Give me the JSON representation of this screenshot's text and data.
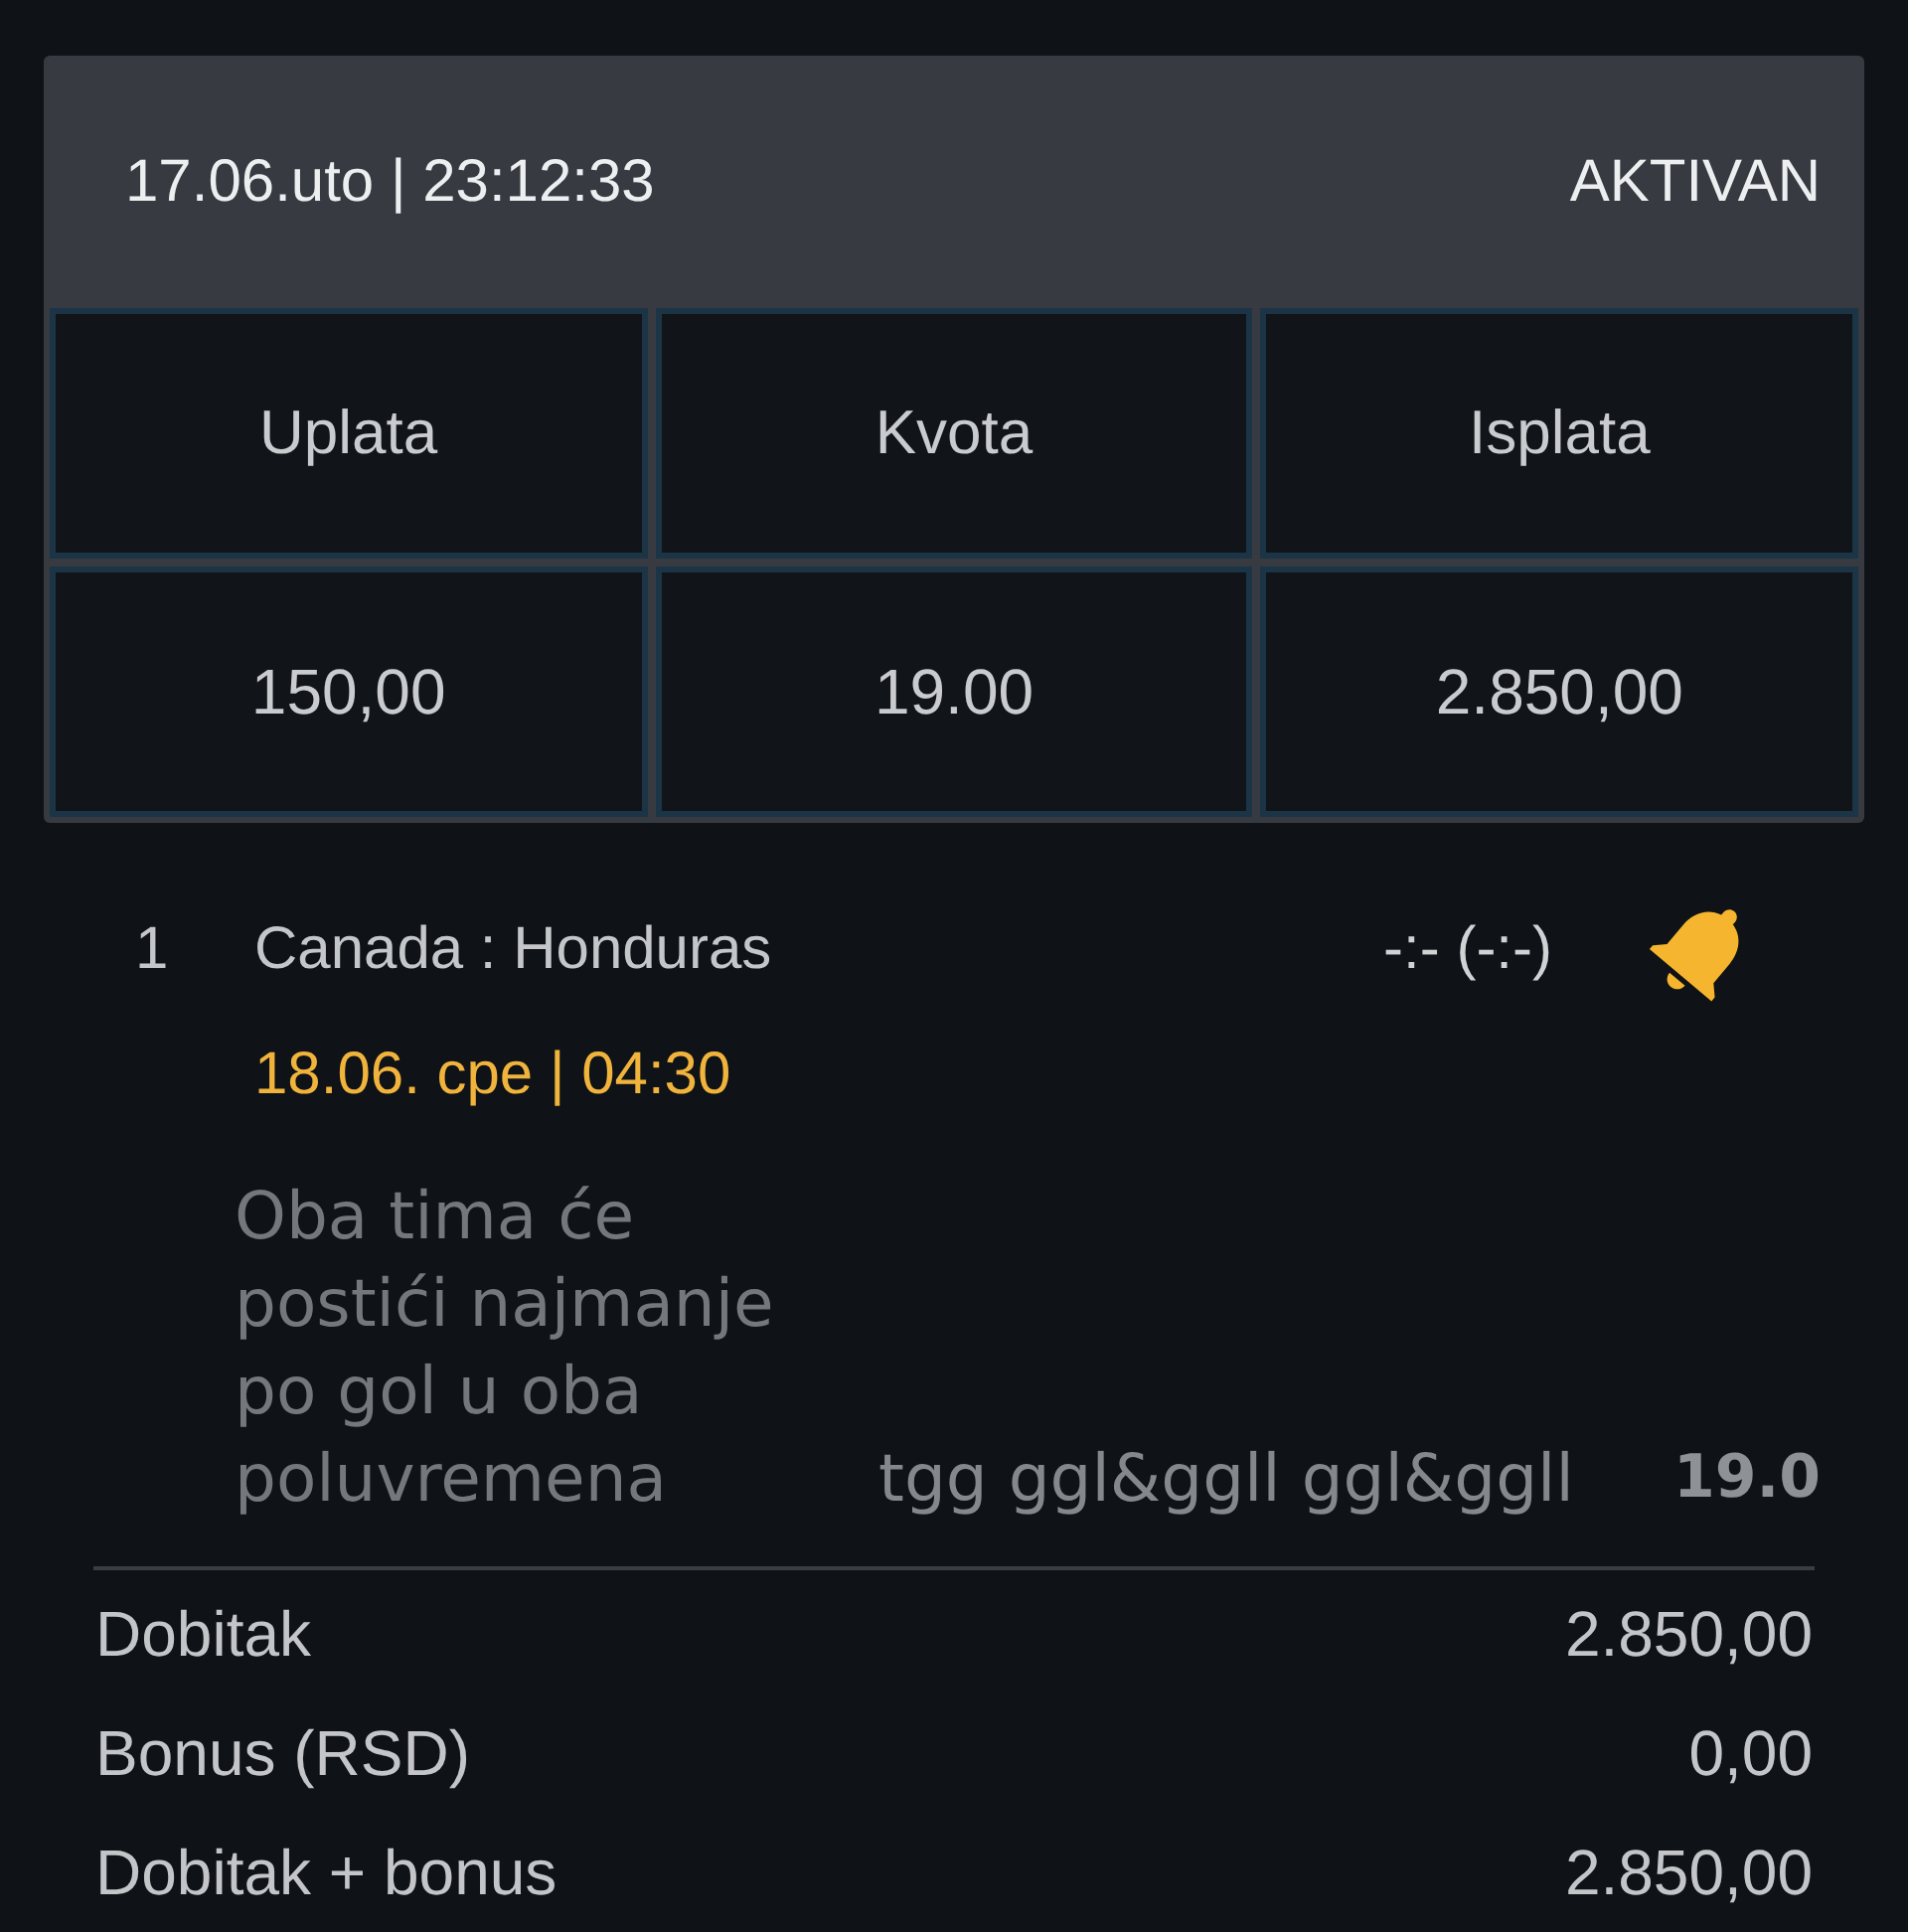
{
  "ticket": {
    "datetime": "17.06.uto | 23:12:33",
    "status": "AKTIVAN"
  },
  "summary_table": {
    "columns": [
      "Uplata",
      "Kvota",
      "Isplata"
    ],
    "values": [
      "150,00",
      "19.00",
      "2.850,00"
    ]
  },
  "matches": [
    {
      "number": "1",
      "teams": "Canada : Honduras",
      "score": "-:- (-:-)",
      "alert_on": true,
      "kickoff": "18.06. cpe | 04:30",
      "market": "Oba tima će postići najmanje po gol u oba poluvremena",
      "pick": "tgg ggl&ggll ggl&ggll",
      "odds": "19.0"
    }
  ],
  "totals": [
    {
      "label": "Dobitak",
      "value": "2.850,00"
    },
    {
      "label": "Bonus (RSD)",
      "value": "0,00"
    },
    {
      "label": "Dobitak + bonus",
      "value": "2.850,00"
    }
  ]
}
